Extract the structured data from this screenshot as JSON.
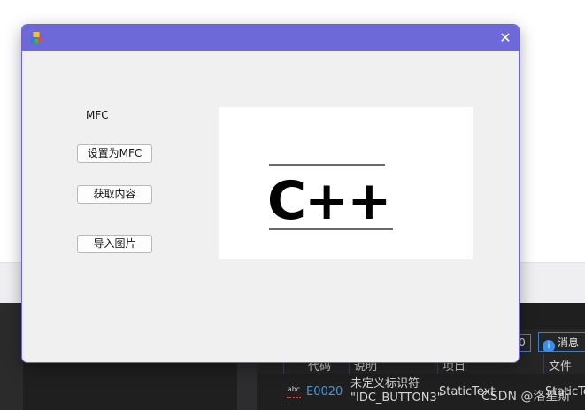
{
  "dialog": {
    "title": "",
    "close_glyph": "✕",
    "static_text": "MFC",
    "buttons": {
      "set_label": "设置为MFC",
      "get_label": "获取内容",
      "import_label": "导入图片"
    },
    "picture": {
      "text": "C++"
    },
    "icons": {
      "app": "app-icon",
      "close": "close-icon"
    }
  },
  "ide": {
    "count": "0",
    "message_label": "消息",
    "columns": [
      "代码",
      "说明",
      "项目",
      "文件"
    ],
    "error_row": {
      "code": "E0020",
      "description_line1": "未定义标识符",
      "description_line2": "\"IDC_BUTTON3\"",
      "project": "StaticText",
      "file": "StaticTex"
    }
  },
  "watermark": "CSDN @洛星斯",
  "colors": {
    "titlebar": "#6e69d8",
    "dialog_bg": "#f0f0f0",
    "ide_bg": "#1f1f1f",
    "error_code": "#4e94ce"
  }
}
